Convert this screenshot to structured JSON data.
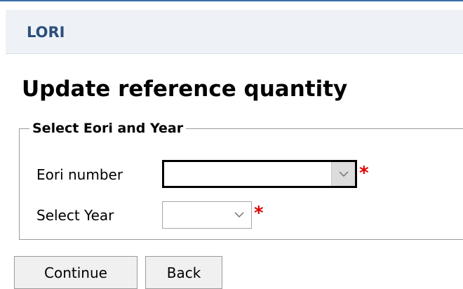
{
  "header": {
    "app_title": "LORI"
  },
  "page": {
    "title": "Update reference quantity"
  },
  "form": {
    "legend": "Select Eori and Year",
    "eori_label": "Eori number",
    "eori_value": "",
    "year_label": "Select Year",
    "year_value": "",
    "required_marker": "*"
  },
  "buttons": {
    "continue_label": "Continue",
    "back_label": "Back"
  },
  "icons": {
    "dropdown": "chevron-down-icon"
  },
  "colors": {
    "app_title": "#2b4f7a",
    "header_bg": "#eef2f7",
    "required": "#e00000"
  }
}
